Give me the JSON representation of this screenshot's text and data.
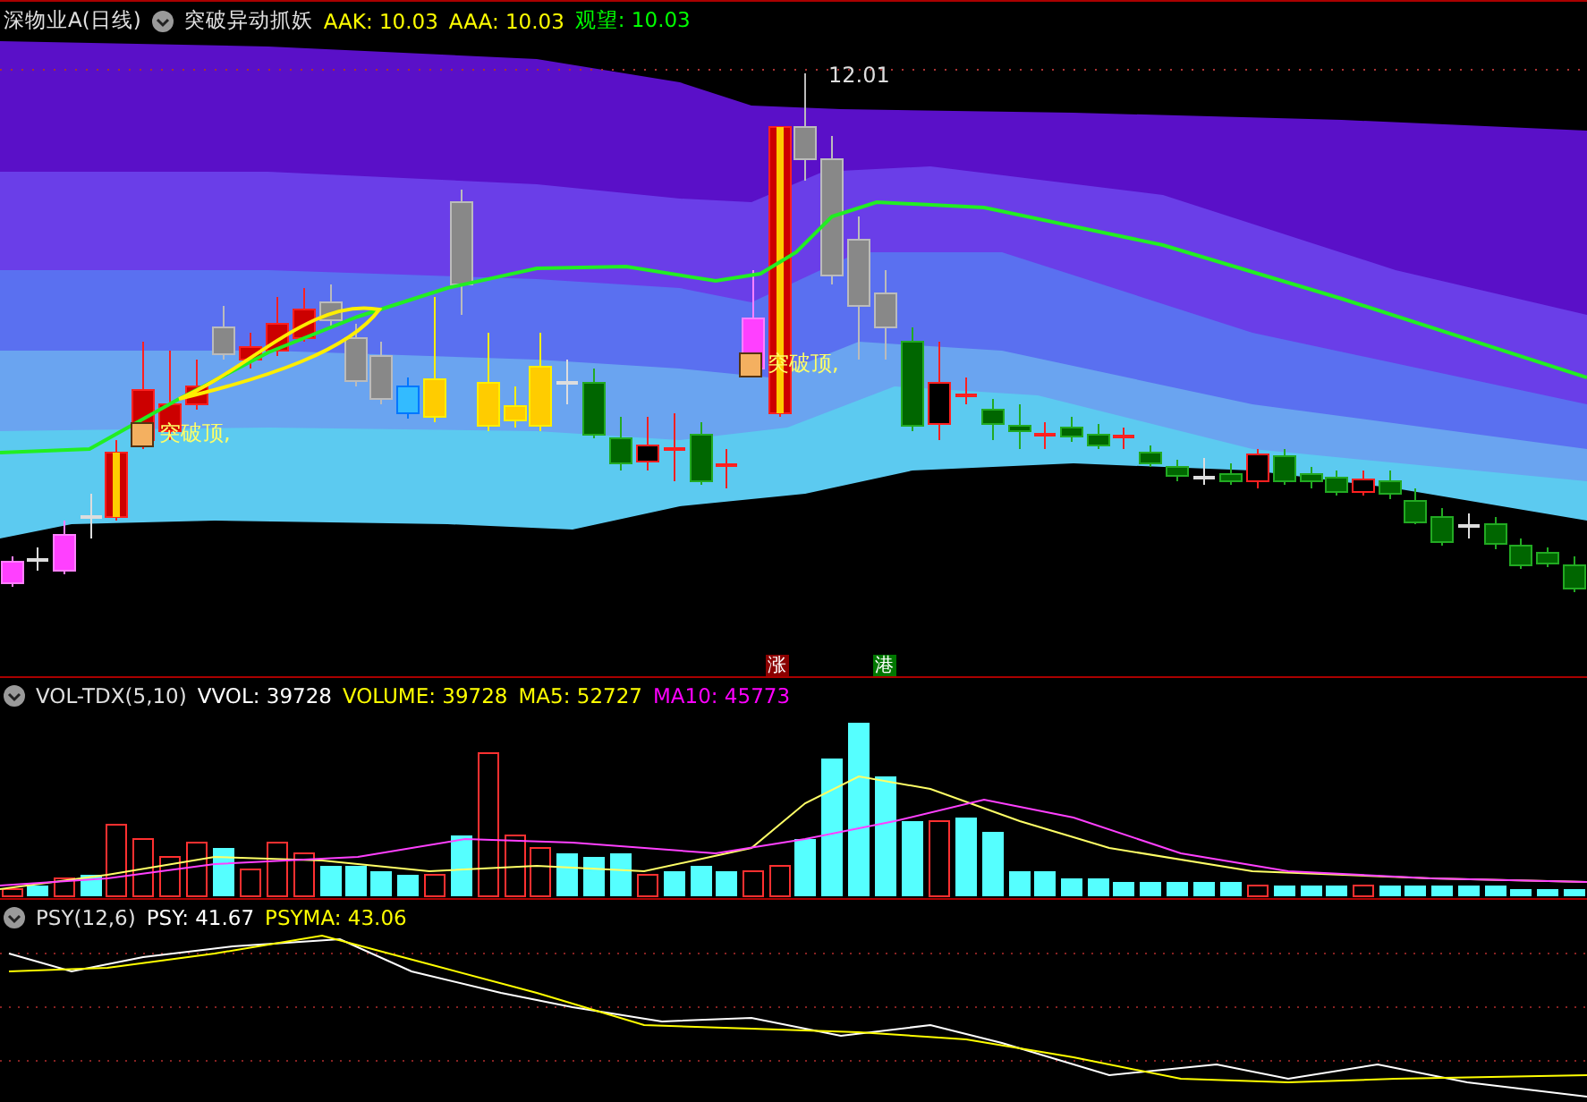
{
  "price_panel": {
    "title": "深物业A(日线)",
    "indicator": "突破异动抓妖",
    "readings": [
      {
        "label": "AAK: 10.03",
        "color": "#ffff00"
      },
      {
        "label": "AAA: 10.03",
        "color": "#ffff00"
      },
      {
        "label": "观望: 10.03",
        "color": "#00ff00"
      }
    ],
    "high_label": "12.01",
    "signals": [
      {
        "text": "突破顶,"
      },
      {
        "text": "突破顶,"
      }
    ],
    "markers": [
      {
        "text": "涨",
        "color": "#8b0000"
      },
      {
        "text": "港",
        "color": "#007700"
      }
    ]
  },
  "volume_panel": {
    "indicator": "VOL-TDX(5,10)",
    "readings": [
      {
        "label": "VVOL: 39728",
        "color": "#ffffff"
      },
      {
        "label": "VOLUME: 39728",
        "color": "#ffff00"
      },
      {
        "label": "MA5: 52727",
        "color": "#ffff00"
      },
      {
        "label": "MA10: 45773",
        "color": "#ff00ff"
      }
    ]
  },
  "psy_panel": {
    "indicator": "PSY(12,6)",
    "readings": [
      {
        "label": "PSY: 41.67",
        "color": "#ffffff"
      },
      {
        "label": "PSYMA: 43.06",
        "color": "#ffff00"
      }
    ]
  }
}
